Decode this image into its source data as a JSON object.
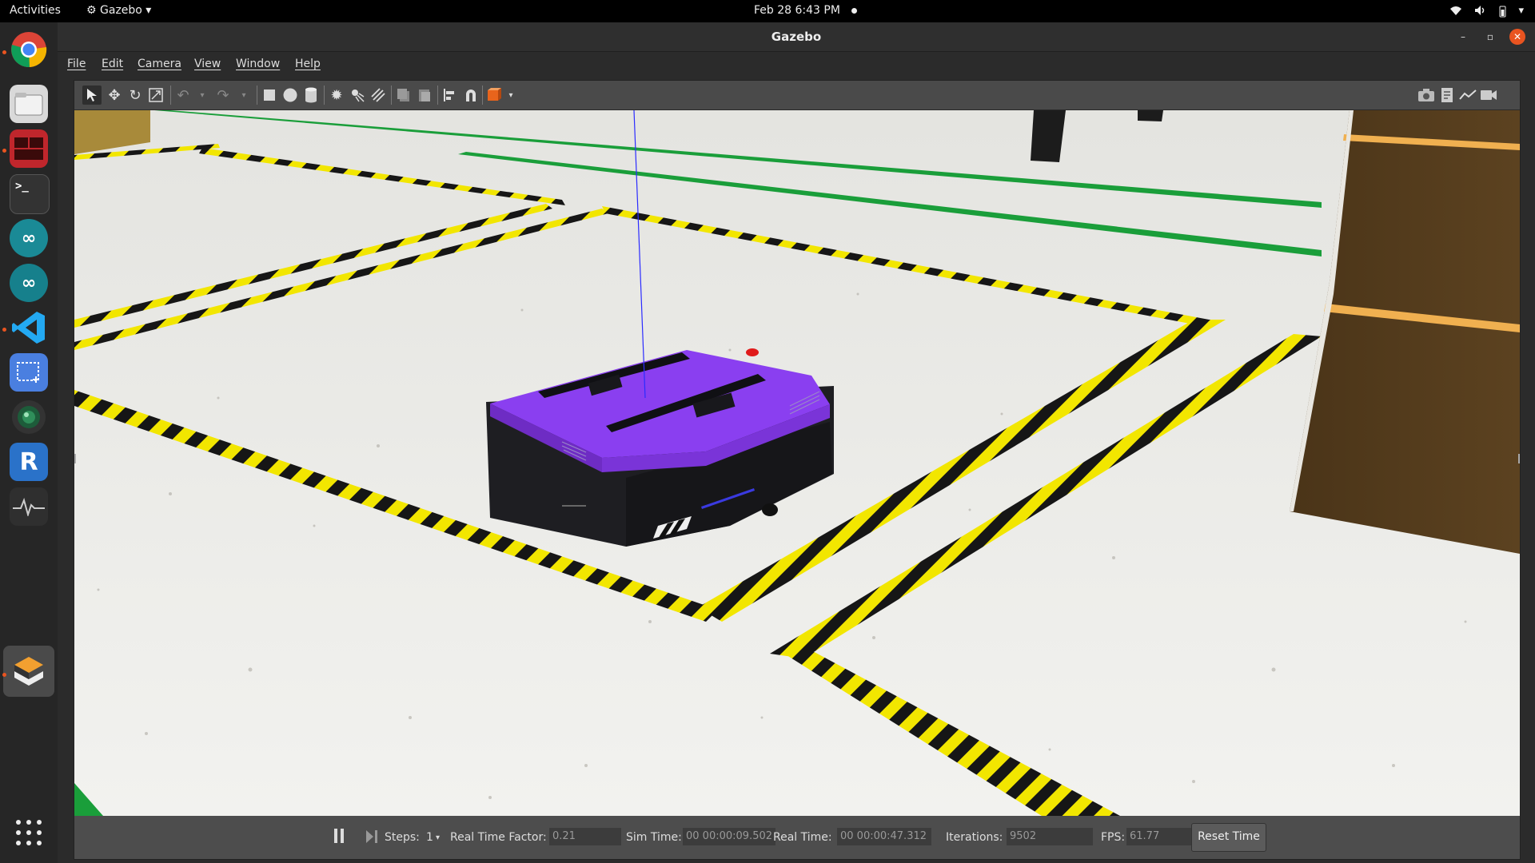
{
  "topbar": {
    "activities": "Activities",
    "app_menu": "Gazebo",
    "clock": "Feb 28  6:43 PM"
  },
  "window": {
    "title": "Gazebo",
    "menu": [
      "File",
      "Edit",
      "Camera",
      "View",
      "Window",
      "Help"
    ]
  },
  "statusbar": {
    "steps_label": "Steps:",
    "steps_value": "1",
    "rtf_label": "Real Time Factor:",
    "rtf_value": "0.21",
    "sim_time_label": "Sim Time:",
    "sim_time_value": "00 00:00:09.502",
    "real_time_label": "Real Time:",
    "real_time_value": "00 00:00:47.312",
    "iterations_label": "Iterations:",
    "iterations_value": "9502",
    "fps_label": "FPS:",
    "fps_value": "61.77",
    "reset_label": "Reset Time"
  },
  "dock": {
    "vnc_label": "R"
  },
  "colors": {
    "robot_top": "#8a3ff0",
    "robot_body": "#1e1e22",
    "tape_yellow": "#f2e600",
    "green_line": "#1a9e3a",
    "accent": "#e95420"
  },
  "icons": {
    "toolbar_left": [
      "select-arrow-icon",
      "translate-icon",
      "rotate-icon",
      "scale-icon",
      "undo-icon",
      "redo-icon",
      "box-icon",
      "sphere-icon",
      "cylinder-icon",
      "point-light-icon",
      "spot-light-icon",
      "directional-light-icon",
      "copy-icon",
      "paste-icon",
      "align-icon",
      "snap-icon",
      "view-angle-icon"
    ],
    "toolbar_right": [
      "screenshot-icon",
      "log-icon",
      "plot-icon",
      "video-record-icon"
    ]
  }
}
